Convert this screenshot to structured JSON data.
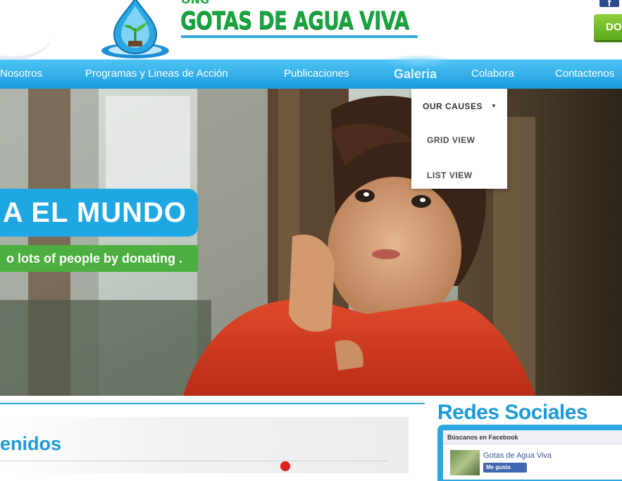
{
  "header": {
    "kicker": "ONG",
    "brand": "GOTAS DE AGUA VIVA",
    "facebook_glyph": "f",
    "donate_label": "DO",
    "colors": {
      "brand_green": "#17a33d",
      "accent_blue": "#1ea7e2",
      "donate_green": "#6ab525"
    }
  },
  "nav": {
    "items": [
      {
        "label": "Nosotros"
      },
      {
        "label": "Programas y Lineas de Acción"
      },
      {
        "label": "Publicaciones"
      },
      {
        "label": "Galeria",
        "active": true
      },
      {
        "label": "Colabora"
      },
      {
        "label": "Contactenos"
      }
    ]
  },
  "dropdown": {
    "items": [
      {
        "label": "OUR CAUSES",
        "has_submenu": true
      },
      {
        "label": "GRID VIEW"
      },
      {
        "label": "LIST VIEW"
      }
    ]
  },
  "hero": {
    "headline": "A EL MUNDO",
    "subline": "o lots of people by donating ."
  },
  "content": {
    "title": "enidos"
  },
  "sidebar": {
    "title": "Redes Sociales",
    "fb_header": "Búscanos en Facebook",
    "fb_page_name": "Gotas de Agua Viva",
    "fb_like": "Me gusta"
  },
  "icons": [
    "logo-drop-icon",
    "facebook-icon",
    "caret-right-icon"
  ]
}
